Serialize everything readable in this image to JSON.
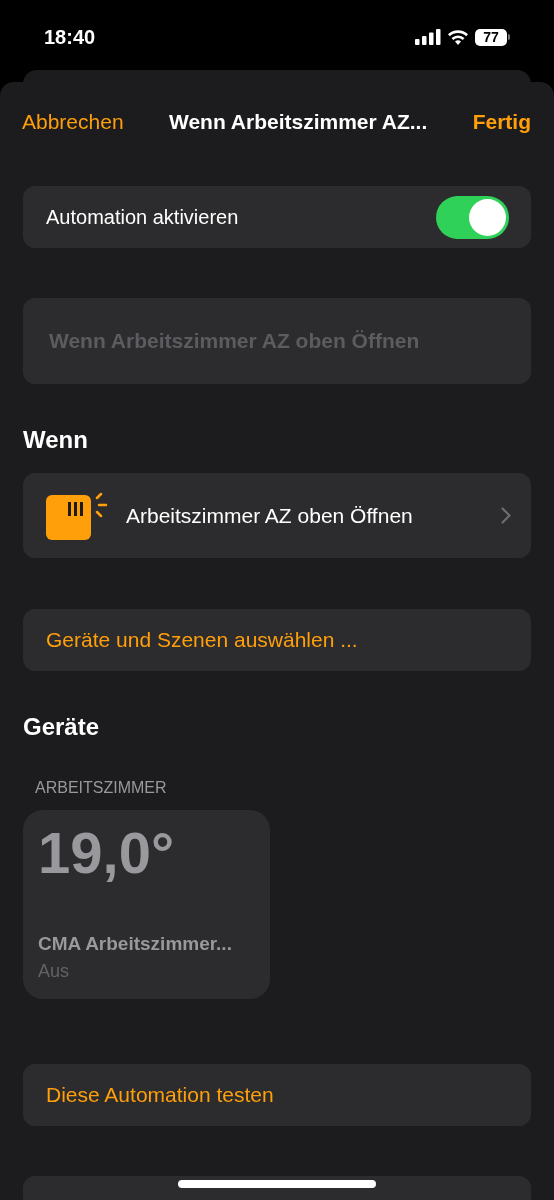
{
  "status_bar": {
    "time": "18:40",
    "battery": "77"
  },
  "nav": {
    "cancel": "Abbrechen",
    "title": "Wenn Arbeitszimmer AZ...",
    "done": "Fertig"
  },
  "enable": {
    "label": "Automation aktivieren",
    "on": true
  },
  "name_field": {
    "placeholder": "Wenn Arbeitszimmer AZ oben Öffnen"
  },
  "when": {
    "heading": "Wenn",
    "trigger": "Arbeitszimmer AZ oben Öffnen"
  },
  "select_button": "Geräte und Szenen auswählen ...",
  "devices": {
    "heading": "Geräte",
    "room": "ARBEITSZIMMER",
    "tiles": [
      {
        "value": "19,0°",
        "name": "CMA Arbeitszimmer...",
        "status": "Aus"
      }
    ]
  },
  "test_button": "Diese Automation testen"
}
